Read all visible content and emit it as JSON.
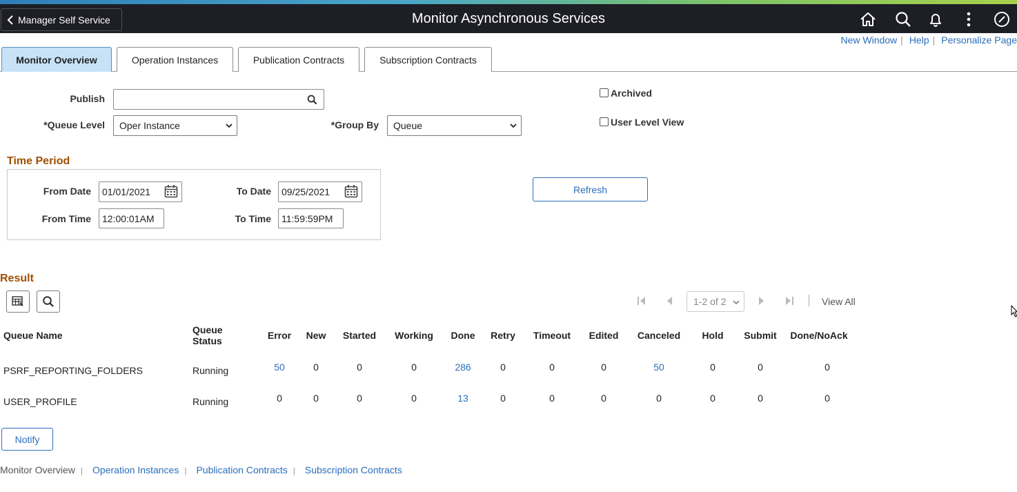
{
  "header": {
    "back_label": "Manager Self Service",
    "title": "Monitor Asynchronous Services",
    "icons": [
      "home-icon",
      "search-icon",
      "notification-bell-icon",
      "actions-menu-icon",
      "navbar-compass-icon"
    ]
  },
  "top_links": [
    "New Window",
    "Help",
    "Personalize Page"
  ],
  "tabs": [
    "Monitor Overview",
    "Operation Instances",
    "Publication Contracts",
    "Subscription Contracts"
  ],
  "form": {
    "publish_label": "Publish",
    "publish_value": "",
    "queue_level_label": "*Queue Level",
    "queue_level_value": "Oper Instance",
    "group_by_label": "*Group By",
    "group_by_value": "Queue",
    "archived_label": "Archived",
    "user_level_view_label": "User Level View"
  },
  "time_period": {
    "title": "Time Period",
    "from_date_label": "From Date",
    "from_date": "01/01/2021",
    "to_date_label": "To Date",
    "to_date": "09/25/2021",
    "from_time_label": "From Time",
    "from_time": "12:00:01AM",
    "to_time_label": "To Time",
    "to_time": "11:59:59PM"
  },
  "refresh_label": "Refresh",
  "result": {
    "title": "Result",
    "pager_text": "1-2 of 2",
    "view_all": "View All",
    "columns": [
      "Queue Name",
      "Queue Status",
      "Error",
      "New",
      "Started",
      "Working",
      "Done",
      "Retry",
      "Timeout",
      "Edited",
      "Canceled",
      "Hold",
      "Submit",
      "Done/NoAck"
    ],
    "queue_status_line1": "Queue",
    "queue_status_line2": "Status",
    "rows": [
      {
        "queue": "PSRF_REPORTING_FOLDERS",
        "status": "Running",
        "error": "50",
        "new": "0",
        "started": "0",
        "working": "0",
        "done": "286",
        "retry": "0",
        "timeout": "0",
        "edited": "0",
        "canceled": "50",
        "hold": "0",
        "submit": "0",
        "done_noack": "0"
      },
      {
        "queue": "USER_PROFILE",
        "status": "Running",
        "error": "0",
        "new": "0",
        "started": "0",
        "working": "0",
        "done": "13",
        "retry": "0",
        "timeout": "0",
        "edited": "0",
        "canceled": "0",
        "hold": "0",
        "submit": "0",
        "done_noack": "0"
      }
    ]
  },
  "notify_label": "Notify",
  "bottom_links": [
    "Monitor Overview",
    "Operation Instances",
    "Publication Contracts",
    "Subscription Contracts"
  ],
  "colors": {
    "header_bg": "#1d1e26",
    "link": "#2a6ebb",
    "section_title": "#a04f00",
    "active_tab": "#c7e1f7"
  }
}
